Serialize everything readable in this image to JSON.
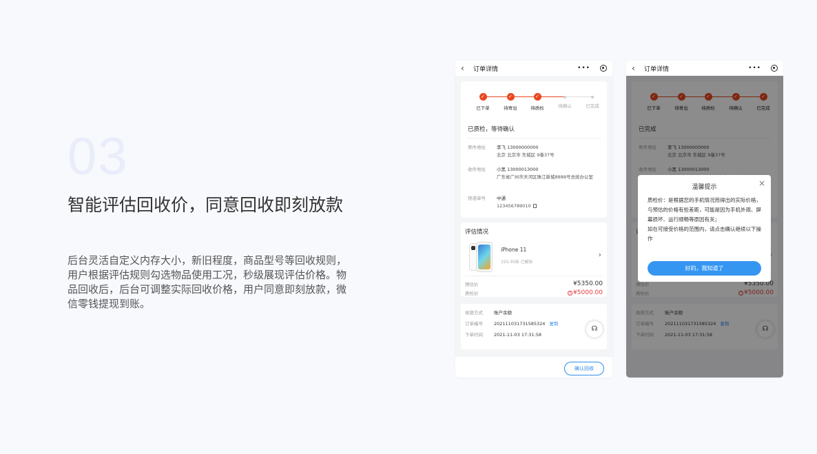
{
  "section": {
    "number": "03",
    "title": "智能评估回收价，同意回收即刻放款",
    "description": "后台灵活自定义内存大小，新旧程度，商品型号等回收规则，用户根据评估规则勾选物品使用工况，秒级展现评估价格。物品回收后，后台可调整实际回收价格，用户同意即刻放款，微信零钱提现到账。"
  },
  "phone": {
    "nav_title": "订单详情",
    "nav_more": "•••",
    "steps": [
      "已下单",
      "待寄出",
      "待质检",
      "待确认",
      "已完成"
    ],
    "step_check": "✓",
    "status_text": "已质检，等待确认",
    "status_text_done": "已完成",
    "sender_label": "寄件地址",
    "sender_name": "李飞  13000000000",
    "sender_addr": "北京 北京市 东城区 9巷37号",
    "receiver_label": "收件地址",
    "receiver_name": "小黑  13000013000",
    "receiver_addr": "广东省广州市天河区珠江新城8888号总统办公室",
    "tracking_label": "快递单号",
    "tracking_carrier": "中通",
    "tracking_number": "123456789010",
    "eval_title": "评估情况",
    "product_model": "iPhone 11",
    "product_spec": "32G 95新 已解除",
    "estimate_label": "预估价",
    "estimate_value": "¥5350.00",
    "qc_label": "质检价",
    "qc_value": "¥5000.00",
    "qc_icon": "?",
    "payment_label": "收款方式",
    "payment_value": "账户余额",
    "order_label": "订单编号",
    "order_value": "2021110317315853​24",
    "copy_label": "复制",
    "time_label": "下单时间",
    "time_value": "2021-11-03 17:31:58",
    "confirm_button": "确认回收",
    "headset_icon": "☊"
  },
  "modal": {
    "title": "温馨提示",
    "close": "×",
    "body_line1": "质检价：是根据您的手机情况而得出的实际价格，与预估的价格有些差距，可能是因为手机外观、屏幕损坏、运行顺畅等原因有关；",
    "body_line2": "如在可接受价格的范围内，请点击确认继续以下操作",
    "ok_button": "好的，我知道了"
  },
  "colors": {
    "accent": "#e8471f",
    "primary": "#2f8ce8",
    "price_red": "#e23c3c"
  }
}
